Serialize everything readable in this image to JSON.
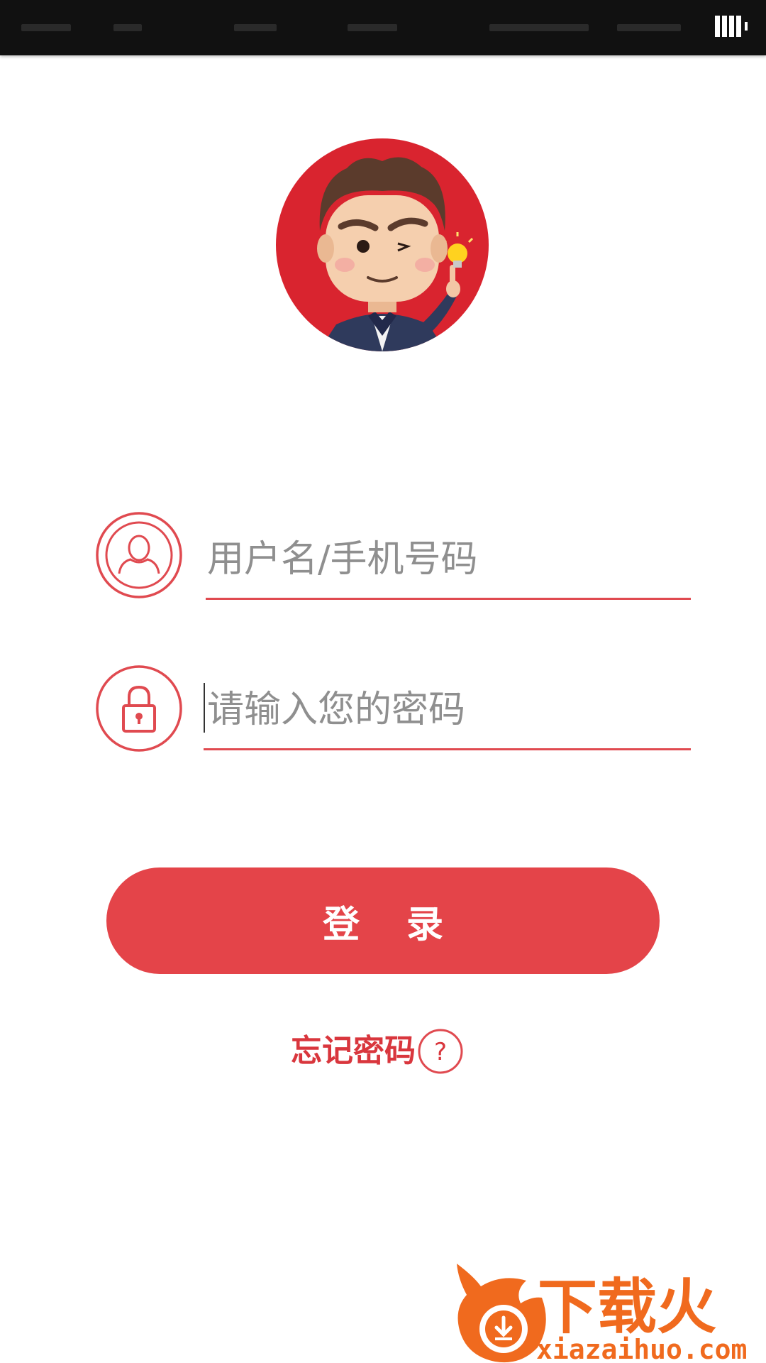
{
  "status_bar": {
    "battery_icon": "battery-full-icon"
  },
  "avatar": {
    "icon": "cartoon-avatar-icon",
    "background_color": "#d9242f"
  },
  "login_form": {
    "username": {
      "icon": "user-icon",
      "placeholder": "用户名/手机号码"
    },
    "password": {
      "icon": "lock-icon",
      "placeholder": "请输入您的密码"
    },
    "login_label": "登 录",
    "forgot_label": "忘记密码",
    "forgot_icon": "question-circle-icon"
  },
  "watermark": {
    "icon": "xiazaihuo-logo",
    "brand": "下载火",
    "domain": "xiazaihuo.com"
  },
  "colors": {
    "accent": "#e44449",
    "line": "#e04a50",
    "placeholder": "#8f8f8f",
    "watermark": "#f06a1e"
  }
}
